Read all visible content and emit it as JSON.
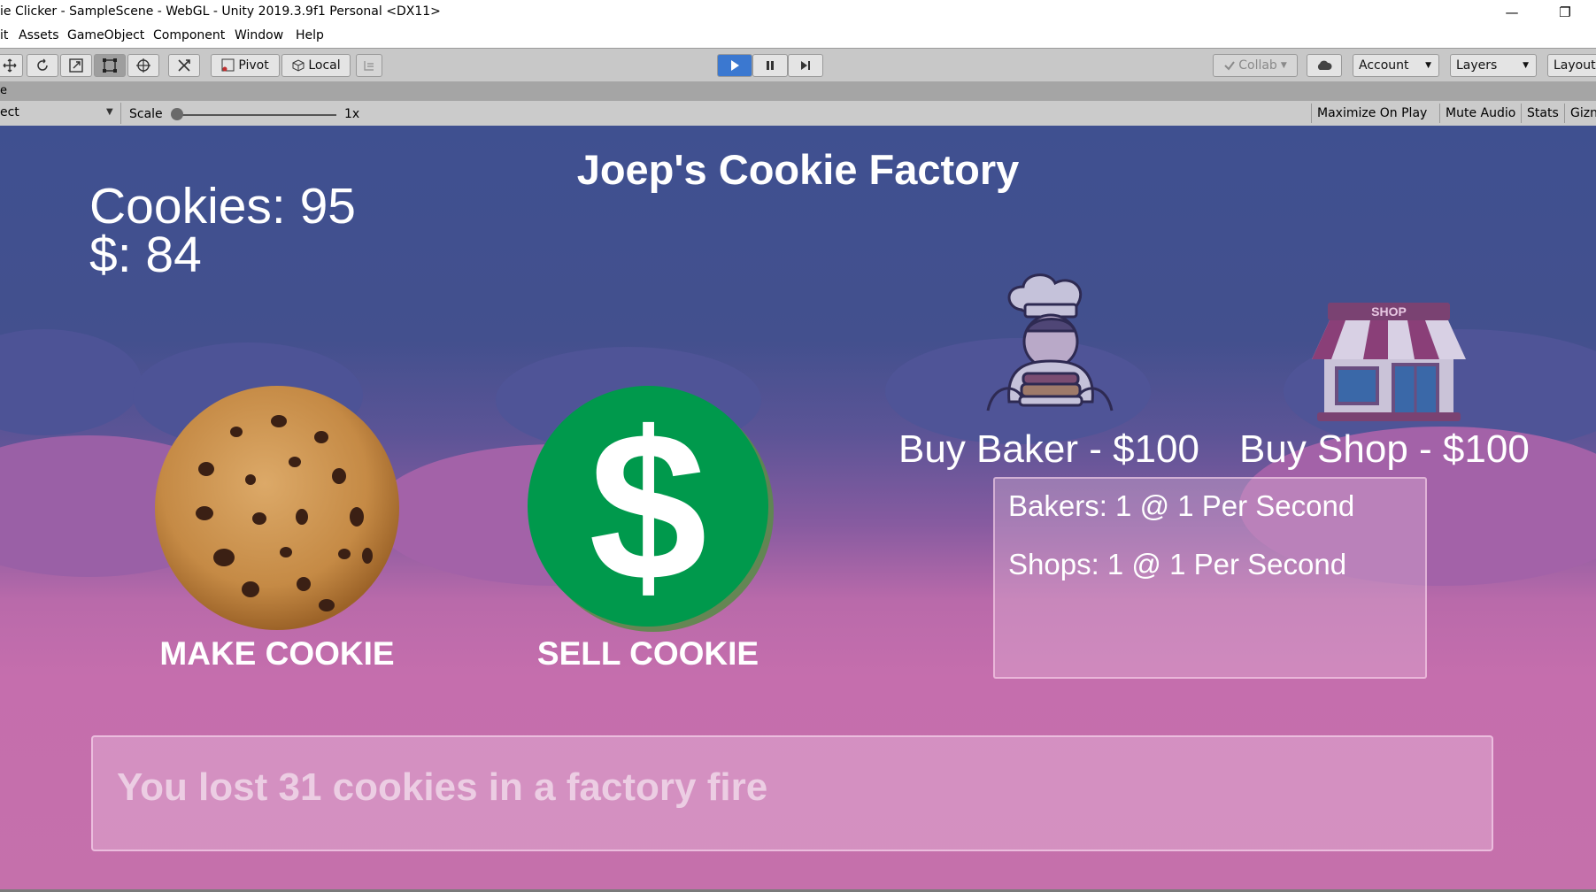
{
  "window": {
    "title": "ie Clicker - SampleScene - WebGL - Unity 2019.3.9f1 Personal <DX11>",
    "minimize_glyph": "—",
    "restore_glyph": "❐"
  },
  "menu": {
    "items": [
      "it",
      "Assets",
      "GameObject",
      "Component",
      "Window",
      "Help"
    ]
  },
  "toolbar": {
    "transform_tools": [
      "move-icon",
      "rotate-icon",
      "scale-icon",
      "rect-icon",
      "transform-icon",
      "custom-tool-icon"
    ],
    "pivot_label": "Pivot",
    "local_label": "Local",
    "collab_label": "Collab",
    "account_label": "Account",
    "layers_label": "Layers",
    "layout_label": "Layout",
    "play_state": "playing"
  },
  "game_tab": {
    "label": "e"
  },
  "game_toolbar": {
    "display_label": "ect",
    "scale_label": "Scale",
    "scale_value": "1x",
    "maximize_label": "Maximize On Play",
    "mute_label": "Mute Audio",
    "stats_label": "Stats",
    "gizmos_label": "Gizn"
  },
  "game": {
    "title": "Joep's Cookie Factory",
    "cookies_text": "Cookies: 95",
    "money_text": "$: 84",
    "make_cookie_label": "MAKE COOKIE",
    "sell_cookie_label": "SELL COOKIE",
    "buy_baker_label": "Buy Baker - $100",
    "buy_shop_label": "Buy Shop - $100",
    "shop_sign": "SHOP",
    "dollar_glyph": "$",
    "info": {
      "bakers": "Bakers: 1 @ 1 Per Second",
      "shops": "Shops: 1 @ 1 Per Second"
    },
    "message": "You lost 31 cookies in a factory fire",
    "colors": {
      "sky_top": "#3f5090",
      "sky_bottom": "#c570ab",
      "sell_button_green": "#00994c",
      "cookie_brown": "#c58a45"
    }
  }
}
